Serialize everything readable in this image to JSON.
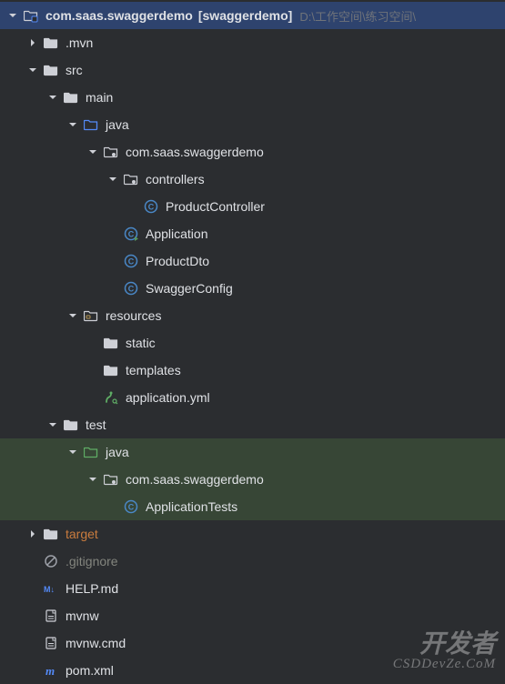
{
  "root": {
    "name": "com.saas.swaggerdemo",
    "suffix": "[swaggerdemo]",
    "path": "D:\\工作空间\\练习空间\\"
  },
  "tree": [
    {
      "depth": 0,
      "arrow": "down",
      "icon": "module",
      "label": "com.saas.swaggerdemo",
      "suffix": "[swaggerdemo]",
      "rootPath": "D:\\工作空间\\练习空间\\",
      "bold": true,
      "sel": true
    },
    {
      "depth": 1,
      "arrow": "right",
      "icon": "folder",
      "label": ".mvn"
    },
    {
      "depth": 1,
      "arrow": "down",
      "icon": "folder",
      "label": "src"
    },
    {
      "depth": 2,
      "arrow": "down",
      "icon": "folder",
      "label": "main"
    },
    {
      "depth": 3,
      "arrow": "down",
      "icon": "src-folder",
      "label": "java"
    },
    {
      "depth": 4,
      "arrow": "down",
      "icon": "package",
      "label": "com.saas.swaggerdemo"
    },
    {
      "depth": 5,
      "arrow": "down",
      "icon": "package",
      "label": "controllers"
    },
    {
      "depth": 6,
      "arrow": "none",
      "icon": "class",
      "label": "ProductController"
    },
    {
      "depth": 5,
      "arrow": "none",
      "icon": "class-run",
      "label": "Application"
    },
    {
      "depth": 5,
      "arrow": "none",
      "icon": "class",
      "label": "ProductDto"
    },
    {
      "depth": 5,
      "arrow": "none",
      "icon": "class",
      "label": "SwaggerConfig"
    },
    {
      "depth": 3,
      "arrow": "down",
      "icon": "res-folder",
      "label": "resources"
    },
    {
      "depth": 4,
      "arrow": "none",
      "icon": "folder",
      "label": "static"
    },
    {
      "depth": 4,
      "arrow": "none",
      "icon": "folder",
      "label": "templates"
    },
    {
      "depth": 4,
      "arrow": "none",
      "icon": "yaml",
      "label": "application.yml"
    },
    {
      "depth": 2,
      "arrow": "down",
      "icon": "folder",
      "label": "test"
    },
    {
      "depth": 3,
      "arrow": "down",
      "icon": "test-folder",
      "label": "java",
      "row": "added"
    },
    {
      "depth": 4,
      "arrow": "down",
      "icon": "package",
      "label": "com.saas.swaggerdemo",
      "row": "added"
    },
    {
      "depth": 5,
      "arrow": "none",
      "icon": "class",
      "label": "ApplicationTests",
      "row": "added"
    },
    {
      "depth": 1,
      "arrow": "right",
      "icon": "folder",
      "label": "target",
      "cls": "target"
    },
    {
      "depth": 1,
      "arrow": "none",
      "icon": "gitignore",
      "label": ".gitignore",
      "cls": "ignored"
    },
    {
      "depth": 1,
      "arrow": "none",
      "icon": "md",
      "label": "HELP.md"
    },
    {
      "depth": 1,
      "arrow": "none",
      "icon": "file",
      "label": "mvnw"
    },
    {
      "depth": 1,
      "arrow": "none",
      "icon": "file",
      "label": "mvnw.cmd"
    },
    {
      "depth": 1,
      "arrow": "none",
      "icon": "maven",
      "label": "pom.xml"
    }
  ],
  "watermark": {
    "line1": "开发者",
    "line2": "CSDDevZe.CoM"
  },
  "indentUnit": 22,
  "icons": {
    "folder": "folder-icon",
    "src-folder": "source-folder-icon",
    "test-folder": "test-folder-icon",
    "res-folder": "resources-folder-icon",
    "package": "package-icon",
    "class": "java-class-icon",
    "class-run": "java-class-runnable-icon",
    "module": "module-icon",
    "yaml": "yaml-file-icon",
    "gitignore": "gitignore-icon",
    "md": "markdown-file-icon",
    "file": "file-icon",
    "maven": "maven-file-icon"
  }
}
